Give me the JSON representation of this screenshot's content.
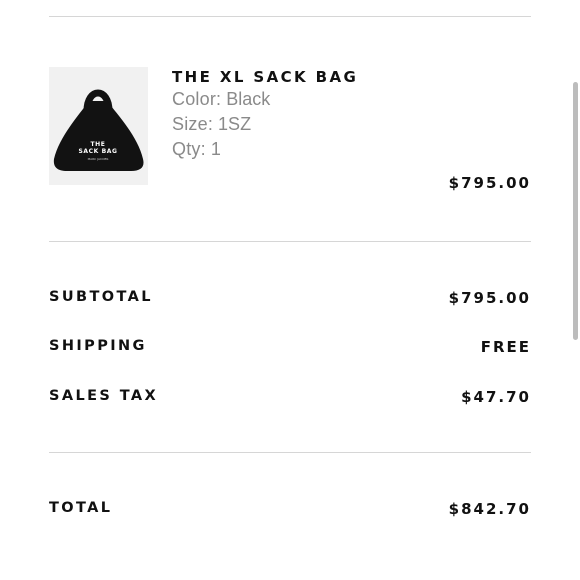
{
  "product": {
    "name": "THE XL SACK BAG",
    "color_label": "Color:",
    "color_value": "Black",
    "size_label": "Size:",
    "size_value": "1SZ",
    "qty_label": "Qty:",
    "qty_value": "1",
    "price": "$795.00",
    "image": {
      "print_line1": "THE",
      "print_line2": "SACK BAG",
      "print_line3": "MARC JACOBS"
    }
  },
  "summary": {
    "subtotal_label": "SUBTOTAL",
    "subtotal_value": "$795.00",
    "shipping_label": "SHIPPING",
    "shipping_value": "FREE",
    "tax_label": "SALES TAX",
    "tax_value": "$47.70",
    "total_label": "TOTAL",
    "total_value": "$842.70"
  },
  "colors": {
    "text": "#111111",
    "muted": "#8a8a8a",
    "divider": "#d6d6d6",
    "bag": "#121212"
  }
}
